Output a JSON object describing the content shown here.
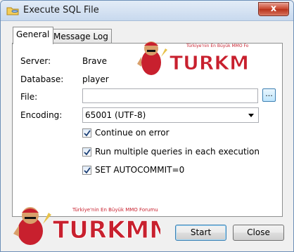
{
  "window": {
    "title": "Execute SQL File",
    "close_symbol": "x"
  },
  "tabs": [
    {
      "label": "General",
      "active": true
    },
    {
      "label": "Message Log",
      "active": false
    }
  ],
  "form": {
    "server_label": "Server:",
    "server_value": "Brave",
    "database_label": "Database:",
    "database_value": "player",
    "file_label": "File:",
    "file_value": "",
    "browse_label": "...",
    "encoding_label": "Encoding:",
    "encoding_value": "65001 (UTF-8)"
  },
  "options": [
    {
      "label": "Continue on error",
      "checked": true
    },
    {
      "label": "Run multiple queries in each execution",
      "checked": true
    },
    {
      "label": "SET AUTOCOMMIT=0",
      "checked": true
    }
  ],
  "buttons": {
    "start": "Start",
    "close": "Close"
  },
  "watermark": {
    "tagline": "Türkiye'nin En Büyük MMO Forumu",
    "brand": "TURKMMO"
  },
  "colors": {
    "accent": "#3c7fb1",
    "title_gradient_top": "#e3ecf7",
    "close_red": "#c7432b",
    "watermark_red": "#c8202e"
  }
}
